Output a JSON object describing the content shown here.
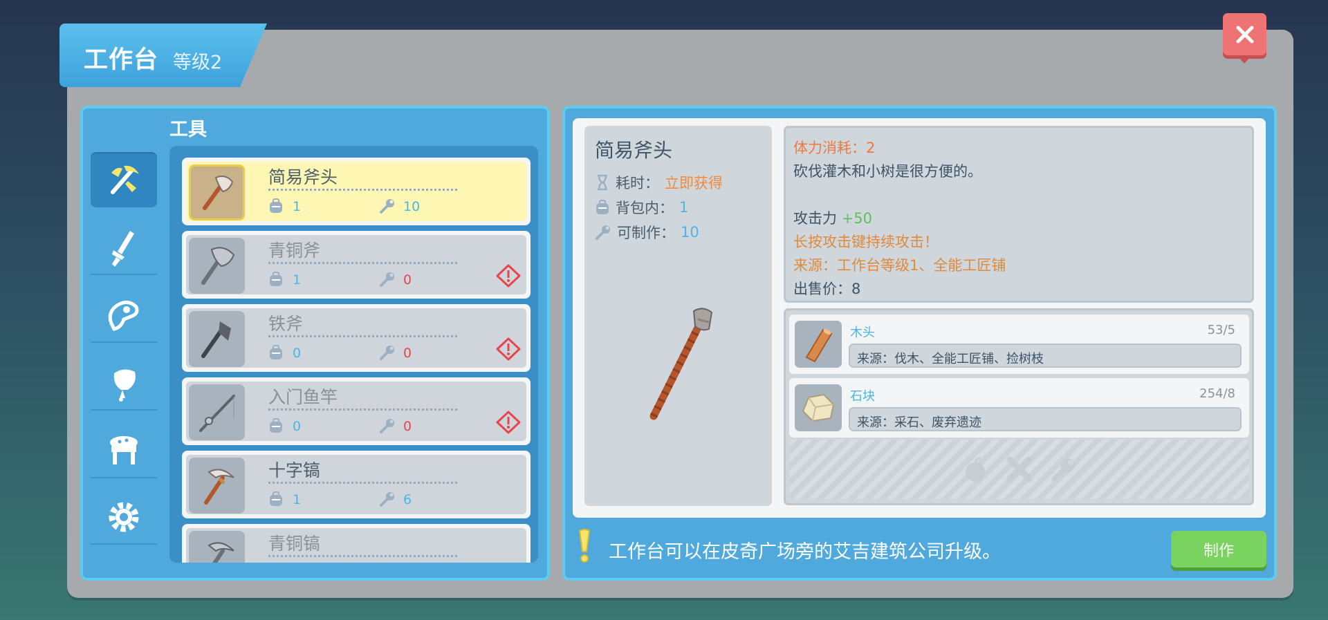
{
  "window": {
    "title": "工作台",
    "level": "等级2",
    "close_label": "X"
  },
  "category": {
    "label": "工具"
  },
  "sidebar": {
    "items": [
      {
        "icon": "pickaxe-axe-icon",
        "active": true
      },
      {
        "icon": "sword-icon"
      },
      {
        "icon": "bandage-icon"
      },
      {
        "icon": "food-icon"
      },
      {
        "icon": "furniture-icon"
      },
      {
        "icon": "gear-icon"
      }
    ]
  },
  "items": [
    {
      "name": "简易斧头",
      "bag": "1",
      "craftable": "10",
      "selected": true,
      "craft_color": "#4bb6e6"
    },
    {
      "name": "青铜斧",
      "bag": "1",
      "craftable": "0",
      "warn": true,
      "craft_color": "#e8454a"
    },
    {
      "name": "铁斧",
      "bag": "0",
      "craftable": "0",
      "warn": true,
      "craft_color": "#e8454a"
    },
    {
      "name": "入门鱼竿",
      "bag": "0",
      "craftable": "0",
      "warn": true,
      "craft_color": "#e8454a"
    },
    {
      "name": "十字镐",
      "bag": "1",
      "craftable": "6",
      "craft_color": "#4bb6e6"
    },
    {
      "name": "青铜镐",
      "bag": "",
      "craftable": ""
    }
  ],
  "detail": {
    "name": "简易斧头",
    "time_label": "耗时：",
    "time_value": "立即获得",
    "bag_label": "背包内：",
    "bag_value": "1",
    "craft_label": "可制作：",
    "craft_value": "10",
    "stamina": "体力消耗：2",
    "description": "砍伐灌木和小树是很方便的。",
    "attack_label": "攻击力",
    "attack_value": "+50",
    "hold_hint": "长按攻击键持续攻击！",
    "source": "来源：工作台等级1、全能工匠铺",
    "sell_price": "出售价：8"
  },
  "materials": [
    {
      "name": "木头",
      "count": "53/5",
      "source": "来源：伐木、全能工匠铺、捡树枝",
      "icon": "wood-log-icon"
    },
    {
      "name": "石块",
      "count": "254/8",
      "source": "来源：采石、废弃遗迹",
      "icon": "stone-icon"
    }
  ],
  "hint": "工作台可以在皮奇广场旁的艾吉建筑公司升级。",
  "make_button": "制作",
  "colors": {
    "accent": "#4fa9dc",
    "highlight": "#fef7b4",
    "warn": "#e8454a",
    "orange": "#f08a3c",
    "green": "#7ad35e"
  }
}
